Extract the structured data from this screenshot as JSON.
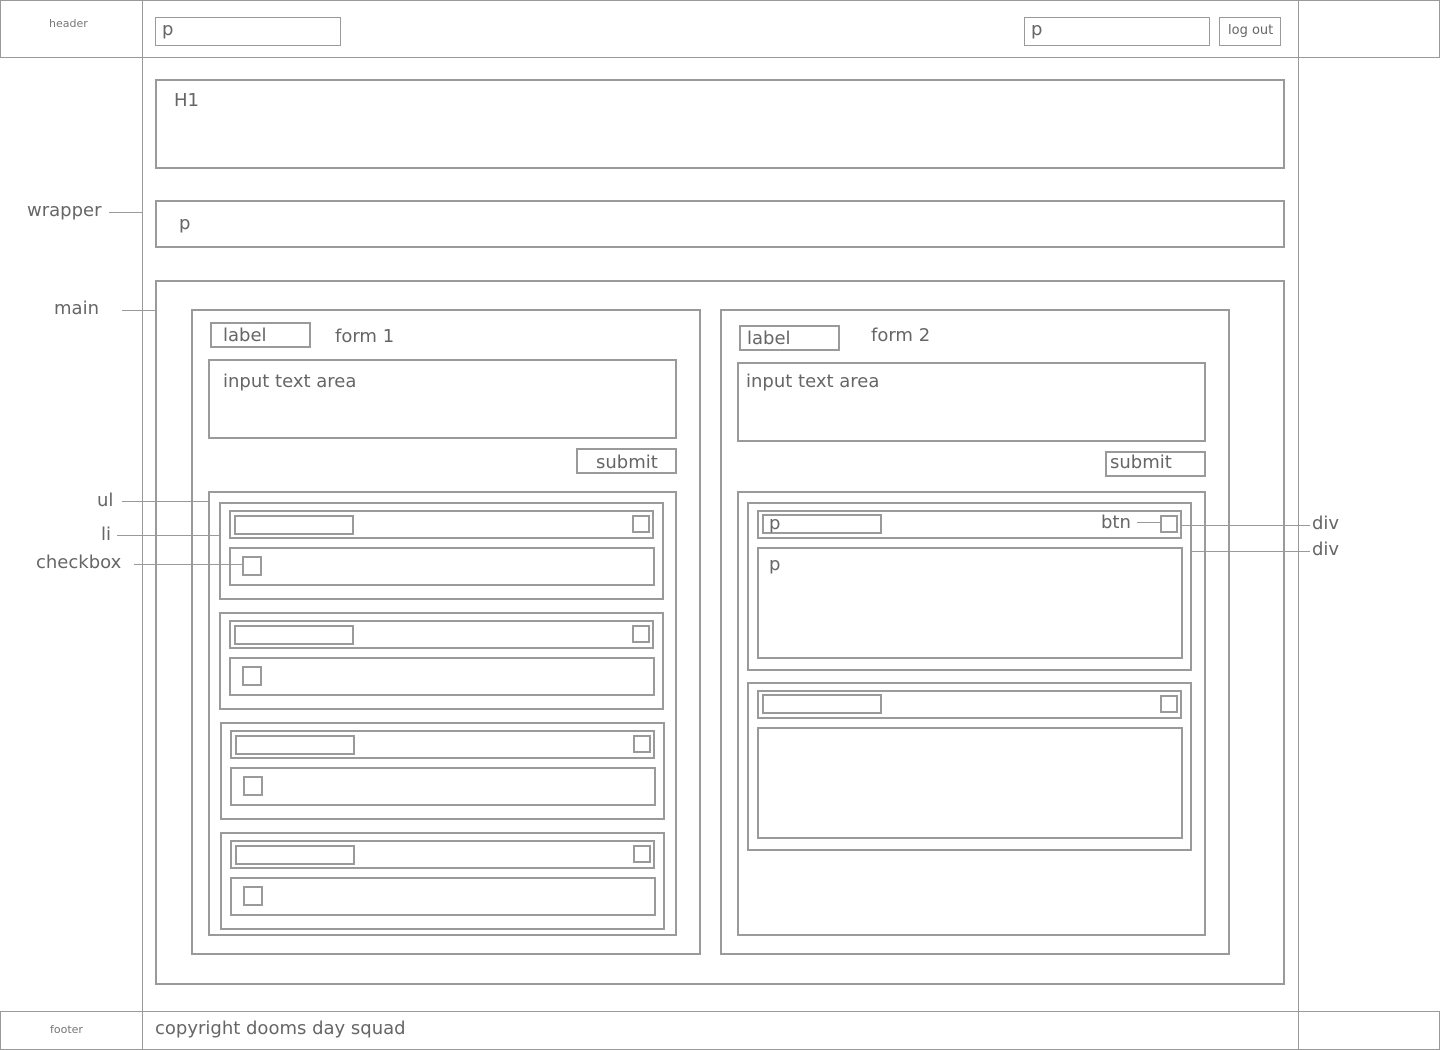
{
  "header": {
    "section_label": "header",
    "left_p": "p",
    "right_p": "p",
    "logout_label": "log out"
  },
  "title_box": {
    "h1": "H1"
  },
  "para_box": {
    "p": "p"
  },
  "annotations": {
    "wrapper": "wrapper",
    "main": "main",
    "ul": "ul",
    "li": "li",
    "checkbox": "checkbox",
    "div_top": "div",
    "div_bottom": "div",
    "btn": "btn"
  },
  "form1": {
    "label": "label",
    "title": "form 1",
    "textarea": "input text area",
    "submit": "submit"
  },
  "form2": {
    "label": "label",
    "title": "form 2",
    "textarea": "input text area",
    "submit": "submit",
    "item1_p": "p",
    "item1_body_p": "p"
  },
  "footer": {
    "section_label": "footer",
    "copyright": "copyright dooms day squad"
  }
}
